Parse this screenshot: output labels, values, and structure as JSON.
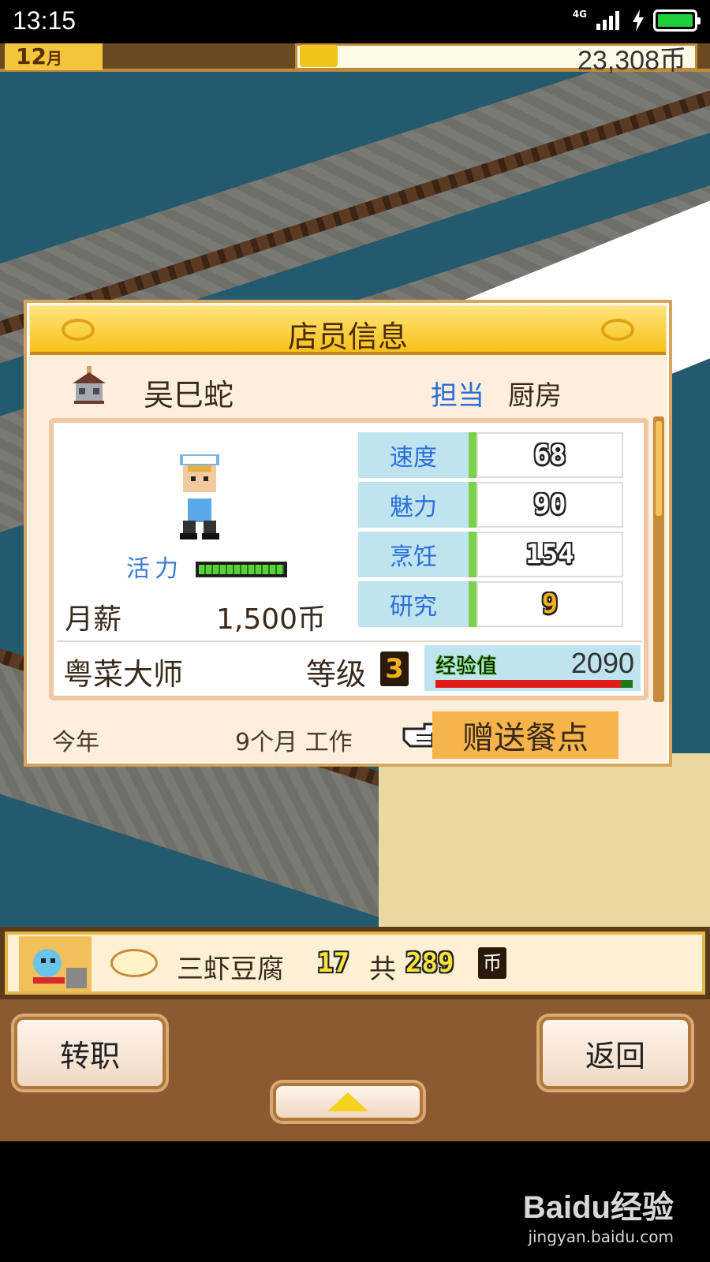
{
  "status_bar": {
    "time": "13:15",
    "network": "4G"
  },
  "top_bar": {
    "month": "12",
    "month_unit": "月",
    "coins": "23,308币"
  },
  "dialog": {
    "title": "店员信息",
    "staff_name": "吴巳蛇",
    "role_label": "担当",
    "role_value": "厨房",
    "vitality_label": "活力",
    "vitality_level": 1.0,
    "salary_label": "月薪",
    "salary_value": "1,500币",
    "stats": [
      {
        "label": "速度",
        "value": "68"
      },
      {
        "label": "魅力",
        "value": "90"
      },
      {
        "label": "烹饪",
        "value": "154"
      },
      {
        "label": "研究",
        "value": "9"
      }
    ],
    "cuisine_title": "粤菜大师",
    "level_label": "等级",
    "level_value": "3",
    "exp_label": "经验值",
    "exp_value": "2090",
    "exp_progress": 0.94,
    "year_label": "今年",
    "work_text": "9个月 工作",
    "gift_button": "赠送餐点"
  },
  "order_strip": {
    "dish_name": "三虾豆腐",
    "count": "17",
    "total_label": "共",
    "total": "289",
    "currency": "币"
  },
  "controls": {
    "transfer_button": "转职",
    "back_button": "返回"
  },
  "watermark": {
    "logo": "Baidu经验",
    "url": "jingyan.baidu.com"
  },
  "colors": {
    "accent_gold": "#f6c11a",
    "stat_label_bg": "#bfe3ef",
    "link_blue": "#2a6ed8"
  }
}
